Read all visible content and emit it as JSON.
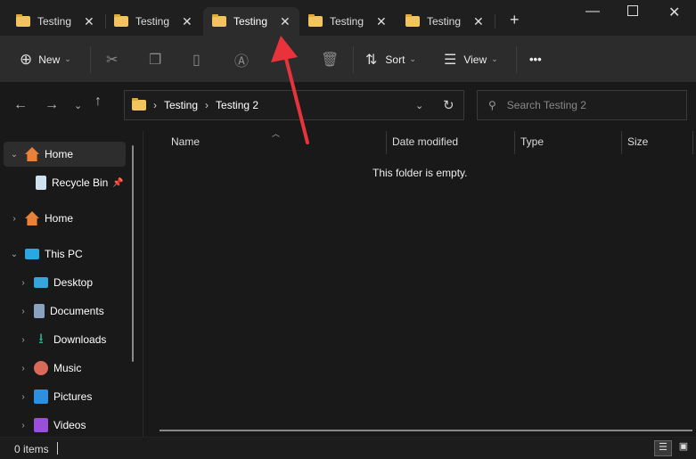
{
  "tabs": [
    {
      "label": "Testing"
    },
    {
      "label": "Testing"
    },
    {
      "label": "Testing"
    },
    {
      "label": "Testing"
    },
    {
      "label": "Testing"
    }
  ],
  "active_tab": 2,
  "toolbar": {
    "new": "New",
    "sort": "Sort",
    "view": "View",
    "more": "•••"
  },
  "address": {
    "segments": [
      "Testing",
      "Testing 2"
    ]
  },
  "search": {
    "placeholder": "Search Testing 2"
  },
  "nav": {
    "items": [
      {
        "label": "Home"
      },
      {
        "label": "Recycle Bin"
      },
      {
        "label": "Home"
      },
      {
        "label": "This PC"
      },
      {
        "label": "Desktop"
      },
      {
        "label": "Documents"
      },
      {
        "label": "Downloads"
      },
      {
        "label": "Music"
      },
      {
        "label": "Pictures"
      },
      {
        "label": "Videos"
      }
    ]
  },
  "columns": [
    "Name",
    "Date modified",
    "Type",
    "Size"
  ],
  "empty_message": "This folder is empty.",
  "status": {
    "items": "0 items"
  },
  "colors": {
    "annotation_arrow": "#e8333a"
  }
}
